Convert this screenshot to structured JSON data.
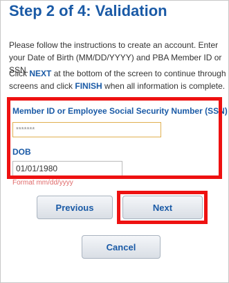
{
  "header": {
    "title": "Step 2 of 4: Validation"
  },
  "instructions": {
    "p1": "Please follow the instructions to create an account. Enter your Date of Birth (MM/DD/YYYY) and PBA Member ID or SSN.",
    "p2_prefix": "Click ",
    "p2_next": "NEXT",
    "p2_middle": " at the bottom of the screen to continue through screens and click ",
    "p2_finish": "FINISH",
    "p2_suffix": " when all information is complete."
  },
  "form": {
    "member_id_label": "Member ID or Employee Social Security Number (SSN)",
    "member_id_value": "*******",
    "dob_label": "DOB",
    "dob_value": "01/01/1980",
    "dob_format_hint": "Format mm/dd/yyyy"
  },
  "buttons": {
    "previous": "Previous",
    "next": "Next",
    "cancel": "Cancel"
  },
  "colors": {
    "accent": "#1a5aa6",
    "highlight": "#ee1111"
  }
}
